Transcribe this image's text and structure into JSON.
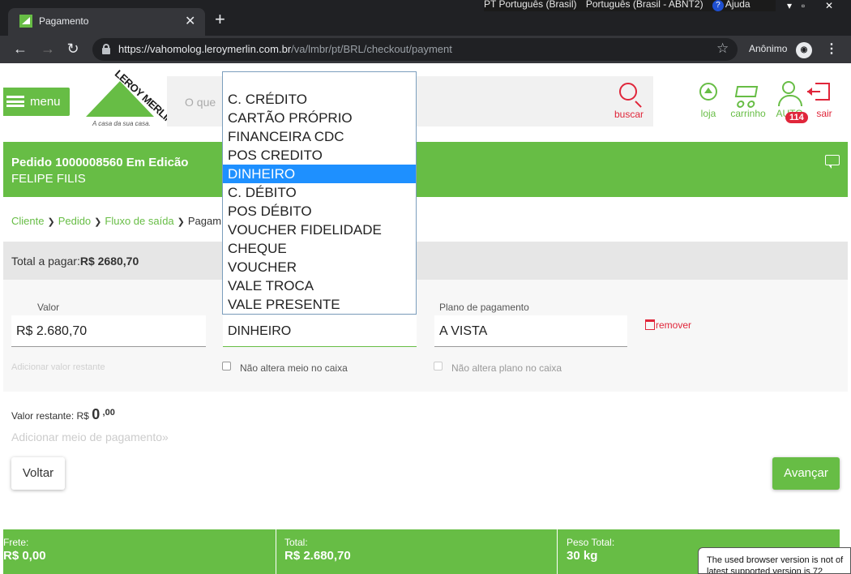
{
  "taskbar": {
    "lang_left": "PT Português (Brasil)",
    "lang_right": "Português (Brasil - ABNT2)",
    "help": "Ajuda"
  },
  "browser": {
    "tab_title": "Pagamento",
    "url_host": "https://vahomolog.leroymerlin.com.br",
    "url_path": "/va/lmbr/pt/BRL/checkout/payment",
    "profile_label": "Anônimo"
  },
  "header": {
    "menu_label": "menu",
    "logo_text": "LEROY MERLIN",
    "logo_slogan": "A casa da sua casa.",
    "search_placeholder": "O que",
    "search_label": "buscar",
    "icons": {
      "store": "loja",
      "cart": "carrinho",
      "user": "AUTO",
      "user_badge": "114",
      "exit": "sair"
    }
  },
  "order": {
    "title": "Pedido 1000008560  Em Edicão",
    "client": "FELIPE FILIS"
  },
  "breadcrumb": [
    "Cliente",
    "Pedido",
    "Fluxo de saída",
    "Pagam"
  ],
  "total": {
    "label": "Total a pagar:",
    "value": "R$ 2680,70"
  },
  "payment": {
    "value_label": "Valor",
    "value": "R$  2.680,70",
    "method": "DINHEIRO",
    "plan_label": "Plano de pagamento",
    "plan": "A VISTA",
    "remove": "remover",
    "add_rest": "Adicionar valor restante",
    "no_change_method": "Não altera meio no caixa",
    "no_change_plan": "Não altera plano no caixa"
  },
  "dropdown": {
    "options": [
      "C. CRÉDITO",
      "CARTÃO PRÓPRIO",
      "FINANCEIRA CDC",
      "POS CREDITO",
      "DINHEIRO",
      "C. DÉBITO",
      "POS DÉBITO",
      "VOUCHER FIDELIDADE",
      "CHEQUE",
      "VOUCHER",
      "VALE TROCA",
      "VALE PRESENTE"
    ],
    "selected": "DINHEIRO"
  },
  "remaining": {
    "label": "Valor restante:",
    "currency": "R$",
    "int": "0",
    "dec": ",00"
  },
  "add_payment": "Adicionar meio de pagamento",
  "buttons": {
    "back": "Voltar",
    "next": "Avançar"
  },
  "footer": {
    "freight_label": "Frete:",
    "freight_value": "R$ 0,00",
    "total_label": "Total:",
    "total_value": "R$ 2.680,70",
    "weight_label": "Peso Total:",
    "weight_value": "30  kg"
  },
  "notice": {
    "line1": "The used browser version is not of",
    "line2": "latest supported version is 72"
  }
}
